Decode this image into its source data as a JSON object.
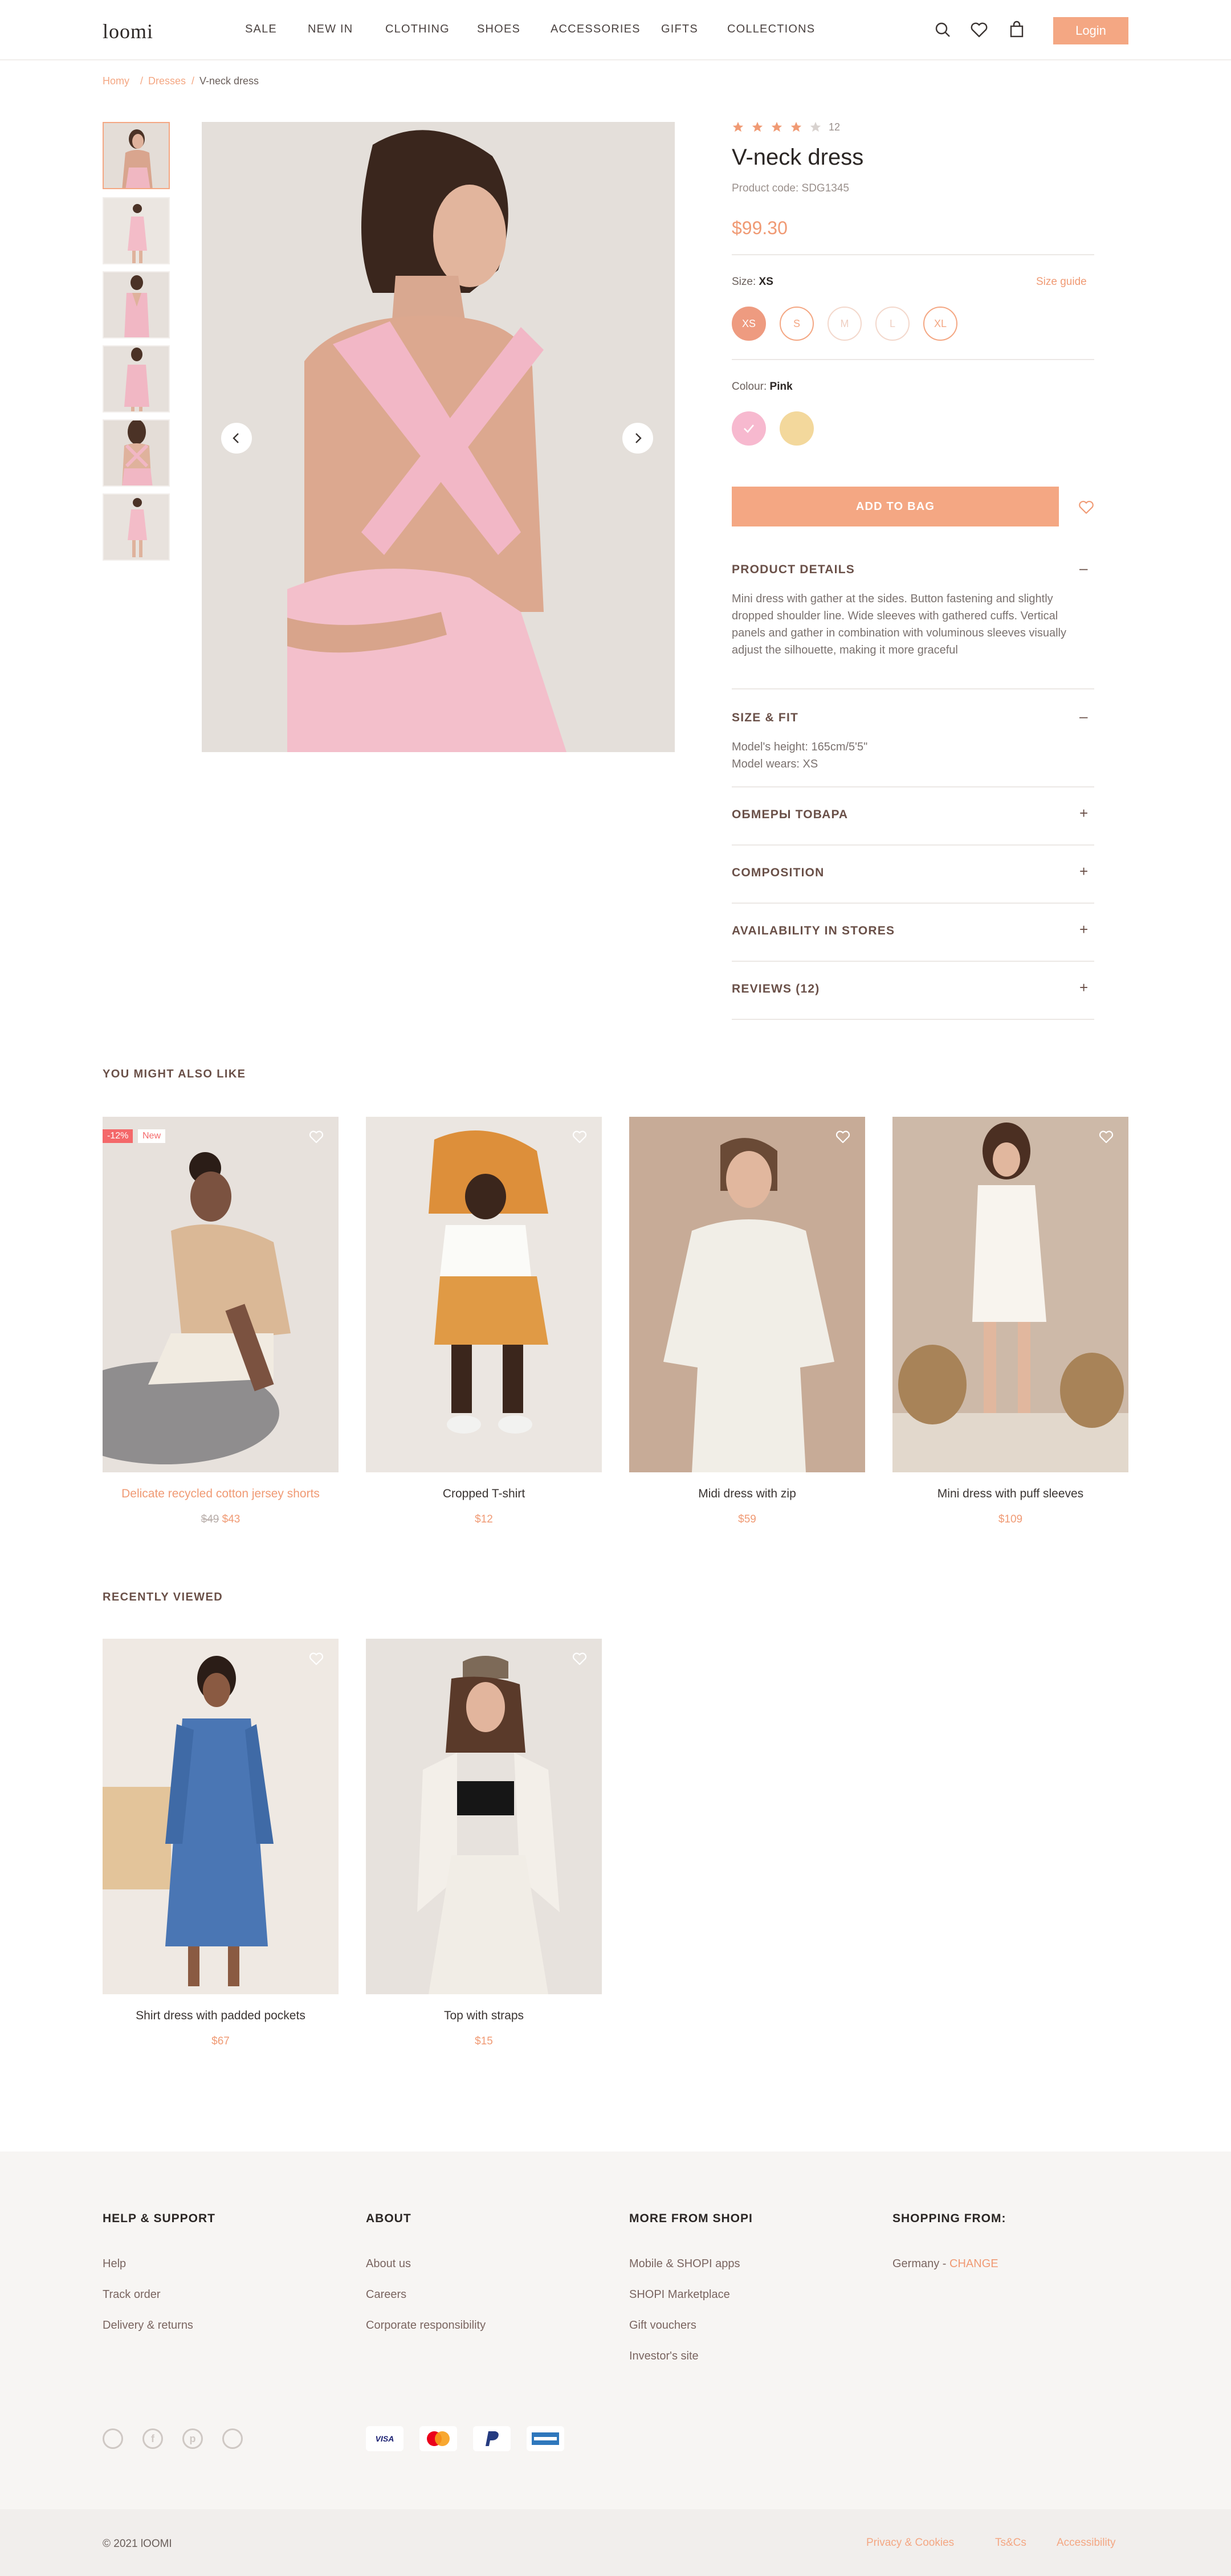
{
  "header": {
    "logo": "loomi",
    "nav": [
      "SALE",
      "NEW IN",
      "CLOTHING",
      "SHOES",
      "ACCESSORIES",
      "GIFTS",
      "COLLECTIONS"
    ],
    "login": "Login"
  },
  "breadcrumb": {
    "home": "Homy",
    "sep1": "/",
    "cat": "Dresses",
    "sep2": "/",
    "current": "V-neck dress"
  },
  "product": {
    "rating_count": "12",
    "rating_value": 4,
    "title": "V-neck dress",
    "code": "Product code: SDG1345",
    "price": "$99.30",
    "size_label": "Size:",
    "size_selected": "XS",
    "size_guide": "Size guide",
    "sizes": [
      "XS",
      "S",
      "M",
      "L",
      "XL"
    ],
    "colour_label": "Colour:",
    "colour_selected": "Pink",
    "colours": [
      "#f7b9cf",
      "#f3d89c"
    ],
    "add_to_bag": "ADD TO BAG",
    "details_title": "PRODUCT DETAILS",
    "details_text": "Mini dress with gather at the sides. Button fastening and slightly dropped shoulder line. Wide sleeves with gathered cuffs. Vertical panels and gather in combination with voluminous sleeves visually adjust the silhouette, making it more graceful",
    "fit_title": "SIZE & FIT",
    "fit_line1": "Model's height: 165cm/5'5\"",
    "fit_line2": "Model wears: XS",
    "acc_measure": "ОБМЕРЫ ТОВАРА",
    "acc_composition": "COMPOSITION",
    "acc_availability": "AVAILABILITY IN STORES",
    "acc_reviews": "REVIEWS (12)",
    "minus": "–",
    "plus": "+"
  },
  "also_like": {
    "title": "YOU MIGHT ALSO LIKE",
    "items": [
      {
        "name": "Delicate recycled cotton jersey shorts",
        "old_price": "$49",
        "price": "$43",
        "discount": "-12%",
        "badge": "New"
      },
      {
        "name": "Cropped T-shirt",
        "price": "$12"
      },
      {
        "name": "Midi dress with zip",
        "price": "$59"
      },
      {
        "name": "Mini dress with puff sleeves",
        "price": "$109"
      }
    ]
  },
  "recent": {
    "title": "RECENTLY VIEWED",
    "items": [
      {
        "name": "Shirt dress with padded pockets",
        "price": "$67"
      },
      {
        "name": "Top with straps",
        "price": "$15"
      }
    ]
  },
  "footer": {
    "col1": {
      "title": "HELP & SUPPORT",
      "links": [
        "Help",
        "Track order",
        "Delivery & returns"
      ]
    },
    "col2": {
      "title": "ABOUT",
      "links": [
        "About us",
        "Careers",
        "Corporate responsibility"
      ]
    },
    "col3": {
      "title": "MORE FROM SHOPI",
      "links": [
        "Mobile & SHOPI apps",
        "SHOPI Marketplace",
        "Gift vouchers",
        "Investor's site"
      ]
    },
    "col4": {
      "title": "SHOPPING FROM:",
      "country": "Germany -",
      "change": "CHANGE"
    },
    "payments": [
      "VISA",
      "mastercard",
      "PayPal",
      "AMERICAN EXPRESS"
    ],
    "copyright": "© 2021 lOOMI",
    "privacy": "Privacy & Cookies",
    "terms": "Ts&Cs",
    "accessibility": "Accessibility"
  },
  "colors": {
    "accent": "#f4a783",
    "price": "#f09a74",
    "footer_bg": "#f7f5f3"
  }
}
